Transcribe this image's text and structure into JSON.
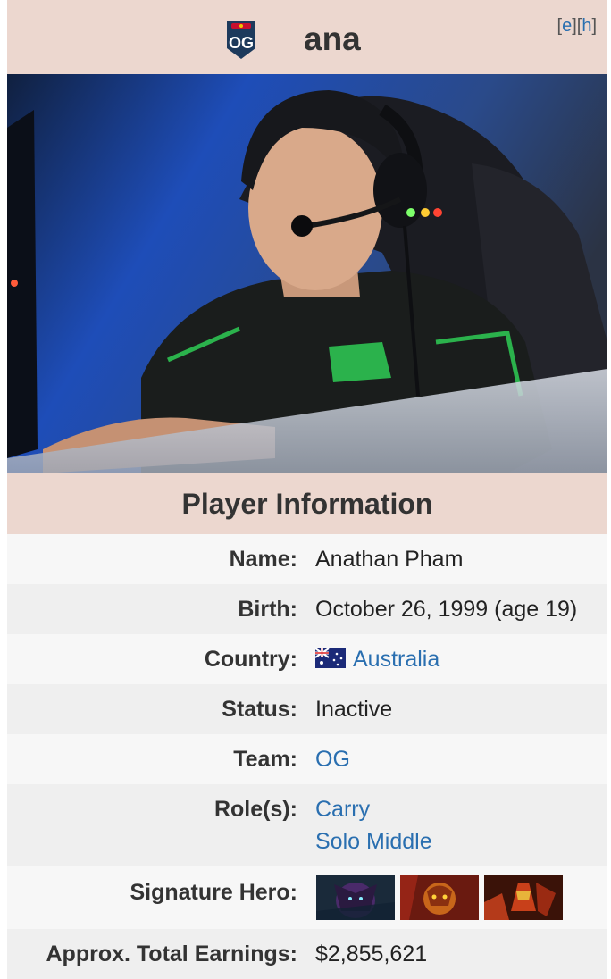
{
  "header": {
    "player_name": "ana",
    "edit_open": "[",
    "edit_e": "e",
    "edit_mid": "][",
    "edit_h": "h",
    "edit_close": "]"
  },
  "logo_text": "OG",
  "section_title": "Player Information",
  "fields": {
    "name": {
      "label": "Name:",
      "value": "Anathan Pham"
    },
    "birth": {
      "label": "Birth:",
      "value": "October 26, 1999 (age 19)"
    },
    "country": {
      "label": "Country:",
      "value": "Australia",
      "flag": "australia-flag"
    },
    "status": {
      "label": "Status:",
      "value": "Inactive"
    },
    "team": {
      "label": "Team:",
      "value": "OG"
    },
    "roles": {
      "label": "Role(s):",
      "values": [
        "Carry",
        "Solo Middle"
      ]
    },
    "signature": {
      "label": "Signature Hero:",
      "heroes": [
        "hero-portrait-1",
        "hero-portrait-2",
        "hero-portrait-3"
      ]
    },
    "earnings": {
      "label": "Approx. Total Earnings:",
      "value": "$2,855,621"
    }
  },
  "colors": {
    "header_bg": "#ecd7cf",
    "link": "#2a6fb0",
    "row_bg": "#f7f7f7",
    "row_alt_bg": "#efefef"
  }
}
